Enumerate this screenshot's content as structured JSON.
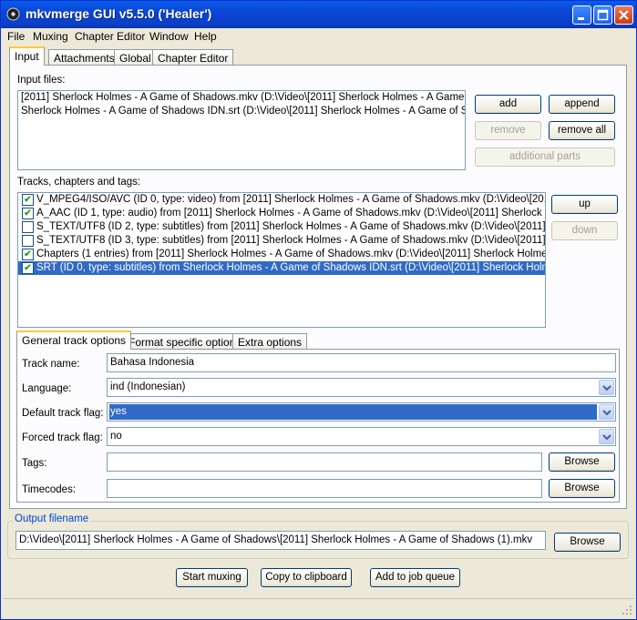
{
  "window": {
    "title": "mkvmerge GUI v5.5.0 ('Healer')"
  },
  "menu": [
    "File",
    "Muxing",
    "Chapter Editor",
    "Window",
    "Help"
  ],
  "main_tabs": [
    "Input",
    "Attachments",
    "Global",
    "Chapter Editor"
  ],
  "input": {
    "files_label": "Input files:",
    "files": [
      "[2011] Sherlock Holmes - A Game of Shadows.mkv (D:\\Video\\[2011] Sherlock Holmes - A Game of Sha",
      "Sherlock Holmes - A Game of Shadows IDN.srt (D:\\Video\\[2011] Sherlock Holmes - A Game of Shadow"
    ],
    "buttons": {
      "add": "add",
      "append": "append",
      "remove": "remove",
      "remove_all": "remove all",
      "additional_parts": "additional parts"
    },
    "tracks_label": "Tracks, chapters and tags:",
    "tracks": [
      {
        "checked": true,
        "text": "V_MPEG4/ISO/AVC (ID 0, type: video) from [2011] Sherlock Holmes - A Game of Shadows.mkv (D:\\Video\\[2011] She"
      },
      {
        "checked": true,
        "text": "A_AAC (ID 1, type: audio) from [2011] Sherlock Holmes - A Game of Shadows.mkv (D:\\Video\\[2011] Sherlock Holmes"
      },
      {
        "checked": false,
        "text": "S_TEXT/UTF8 (ID 2, type: subtitles) from [2011] Sherlock Holmes - A Game of Shadows.mkv (D:\\Video\\[2011] Sherlo"
      },
      {
        "checked": false,
        "text": "S_TEXT/UTF8 (ID 3, type: subtitles) from [2011] Sherlock Holmes - A Game of Shadows.mkv (D:\\Video\\[2011] Sherlo"
      },
      {
        "checked": true,
        "text": "Chapters (1 entries) from [2011] Sherlock Holmes - A Game of Shadows.mkv (D:\\Video\\[2011] Sherlock Holmes - A G"
      },
      {
        "checked": true,
        "text": "SRT (ID 0, type: subtitles) from Sherlock Holmes - A Game of Shadows IDN.srt (D:\\Video\\[2011] Sherlock Holmes - A",
        "selected": true
      }
    ],
    "track_buttons": {
      "up": "up",
      "down": "down"
    }
  },
  "options_tabs": [
    "General track options",
    "Format specific options",
    "Extra options"
  ],
  "general": {
    "track_name_label": "Track name:",
    "track_name": "Bahasa Indonesia",
    "language_label": "Language:",
    "language": "ind (Indonesian)",
    "default_flag_label": "Default track flag:",
    "default_flag": "yes",
    "forced_flag_label": "Forced track flag:",
    "forced_flag": "no",
    "tags_label": "Tags:",
    "tags": "",
    "timecodes_label": "Timecodes:",
    "timecodes": "",
    "browse": "Browse"
  },
  "output": {
    "label": "Output filename",
    "filename": "D:\\Video\\[2011] Sherlock Holmes - A Game of Shadows\\[2011] Sherlock Holmes - A Game of Shadows (1).mkv",
    "browse": "Browse"
  },
  "actions": {
    "start": "Start muxing",
    "copy": "Copy to clipboard",
    "queue": "Add to job queue"
  }
}
